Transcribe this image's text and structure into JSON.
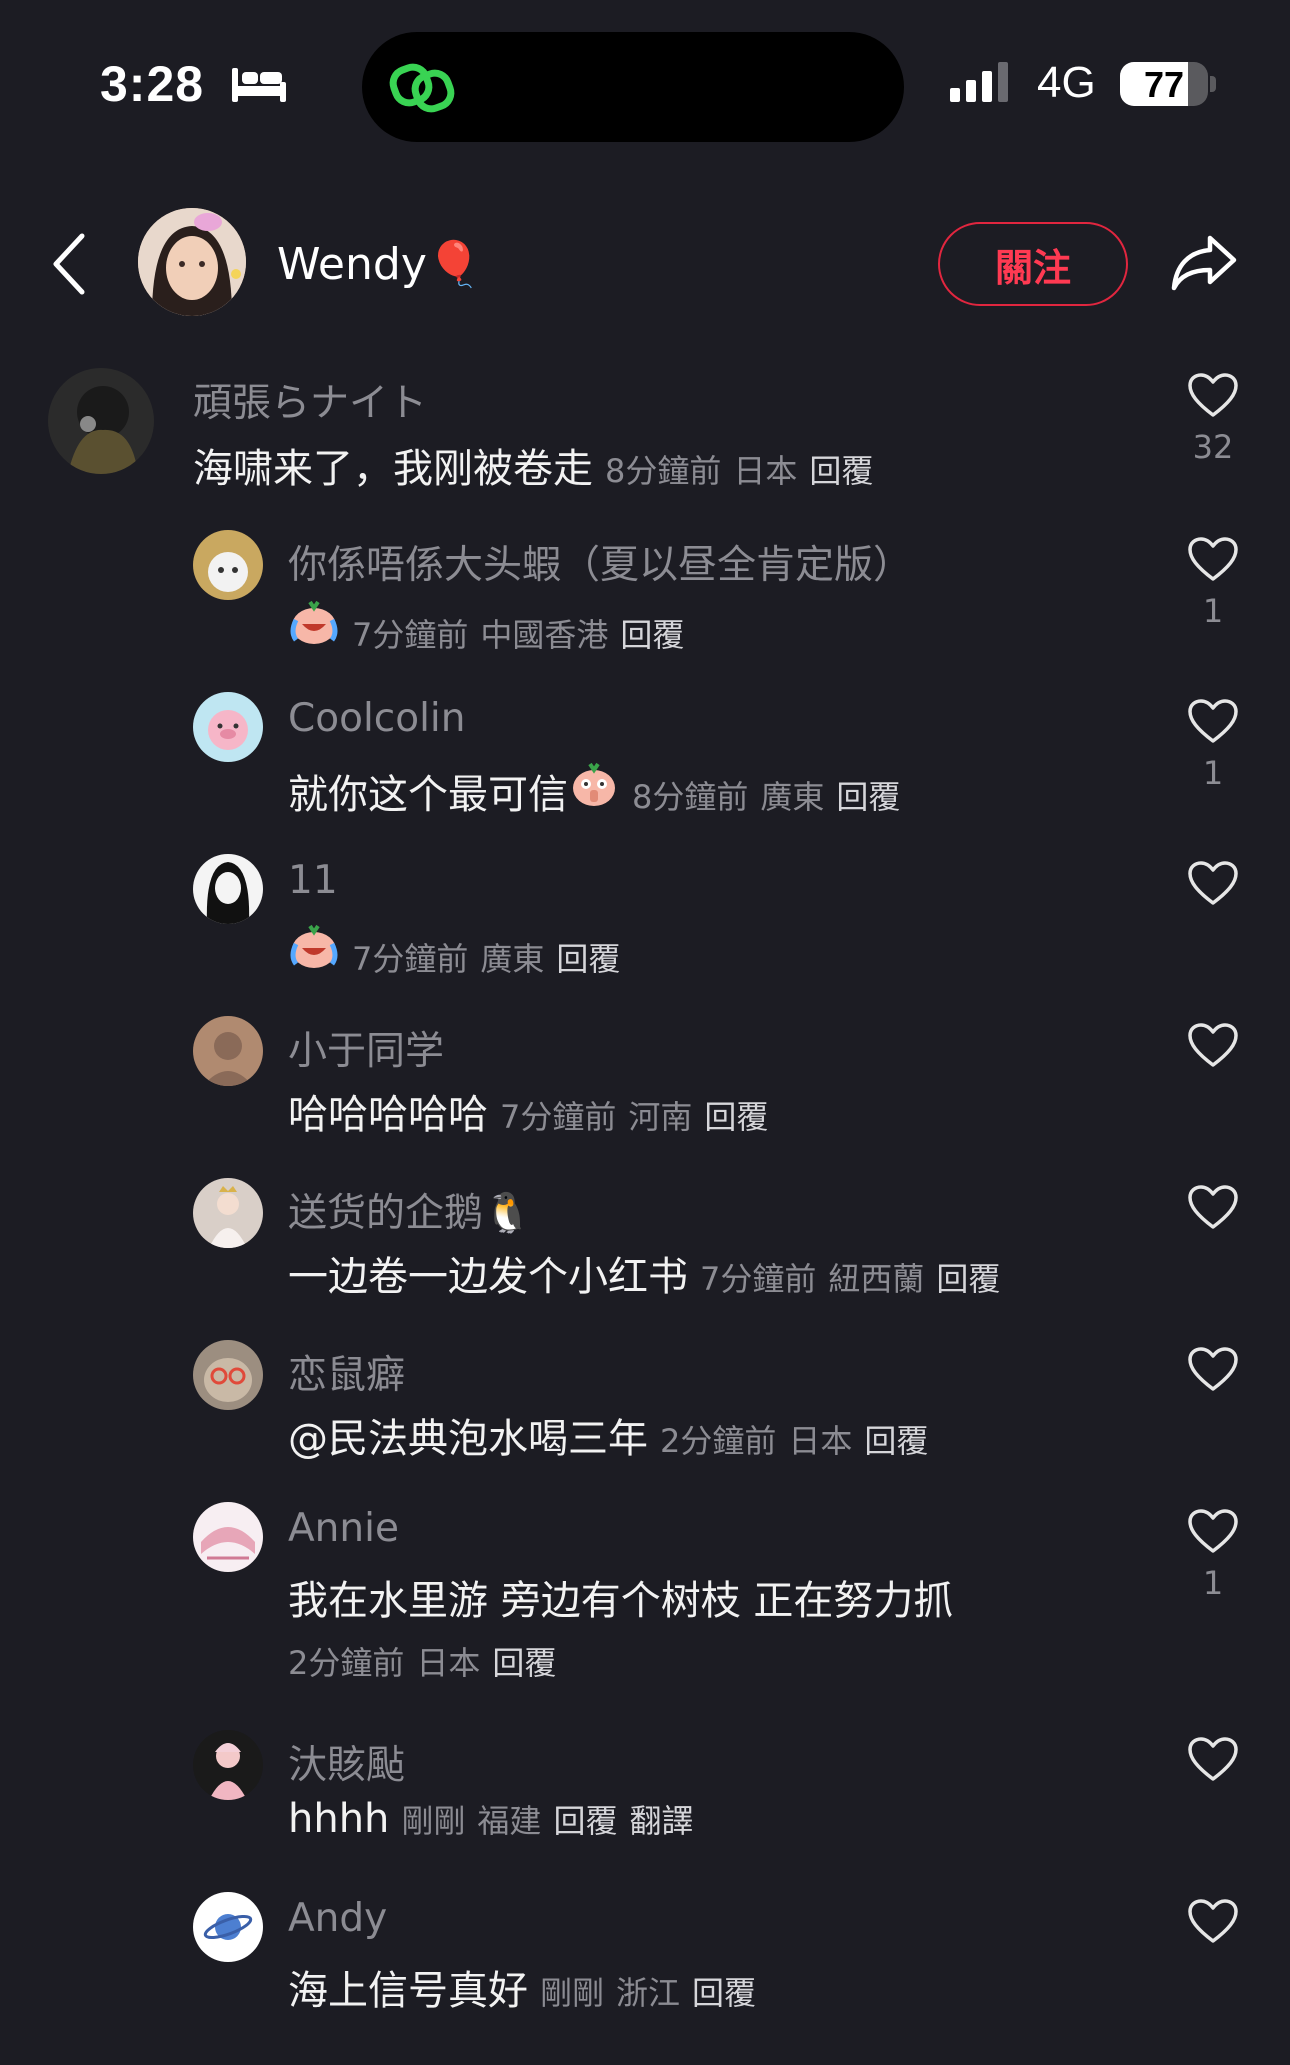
{
  "status_bar": {
    "time": "3:28",
    "network": "4G",
    "battery": "77",
    "battery_level": 0.77,
    "icons": [
      "bed-icon",
      "link-icon",
      "signal-icon",
      "battery-icon"
    ]
  },
  "header": {
    "author_name": "Wendy🎈",
    "follow_label": "關注",
    "icons": [
      "back-icon",
      "share-icon"
    ]
  },
  "comments": [
    {
      "user": "頑張らナイト",
      "text": "海啸来了，我刚被卷走",
      "time": "8分鐘前",
      "location": "日本",
      "reply": "回覆",
      "likes": "32"
    },
    {
      "user": "你係唔係大头蝦（夏以昼全肯定版）",
      "text": "",
      "emoji": "crying-laughing-emoji",
      "time": "7分鐘前",
      "location": "中國香港",
      "reply": "回覆",
      "likes": "1"
    },
    {
      "user": "Coolcolin",
      "text": "就你这个最可信",
      "emoji": "shush-emoji",
      "time": "8分鐘前",
      "location": "廣東",
      "reply": "回覆",
      "likes": "1"
    },
    {
      "user": "11",
      "text": "",
      "emoji": "crying-laughing-emoji",
      "time": "7分鐘前",
      "location": "廣東",
      "reply": "回覆",
      "likes": ""
    },
    {
      "user": "小于同学",
      "text": "哈哈哈哈哈",
      "time": "7分鐘前",
      "location": "河南",
      "reply": "回覆",
      "likes": ""
    },
    {
      "user": "送货的企鹅🐧",
      "text": "一边卷一边发个小红书",
      "time": "7分鐘前",
      "location": "紐西蘭",
      "reply": "回覆",
      "likes": ""
    },
    {
      "user": "恋鼠癖",
      "text": "@民法典泡水喝三年",
      "time": "2分鐘前",
      "location": "日本",
      "reply": "回覆",
      "likes": ""
    },
    {
      "user": "Annie",
      "text": "我在水里游 旁边有个树枝 正在努力抓",
      "time": "2分鐘前",
      "location": "日本",
      "reply": "回覆",
      "likes": "1"
    },
    {
      "user": "汏賅颭",
      "text": "hhhh",
      "time": "剛剛",
      "location": "福建",
      "reply": "回覆",
      "translate": "翻譯",
      "likes": ""
    },
    {
      "user": "Andy",
      "text": "海上信号真好",
      "time": "剛剛",
      "location": "浙江",
      "reply": "回覆",
      "likes": ""
    }
  ]
}
